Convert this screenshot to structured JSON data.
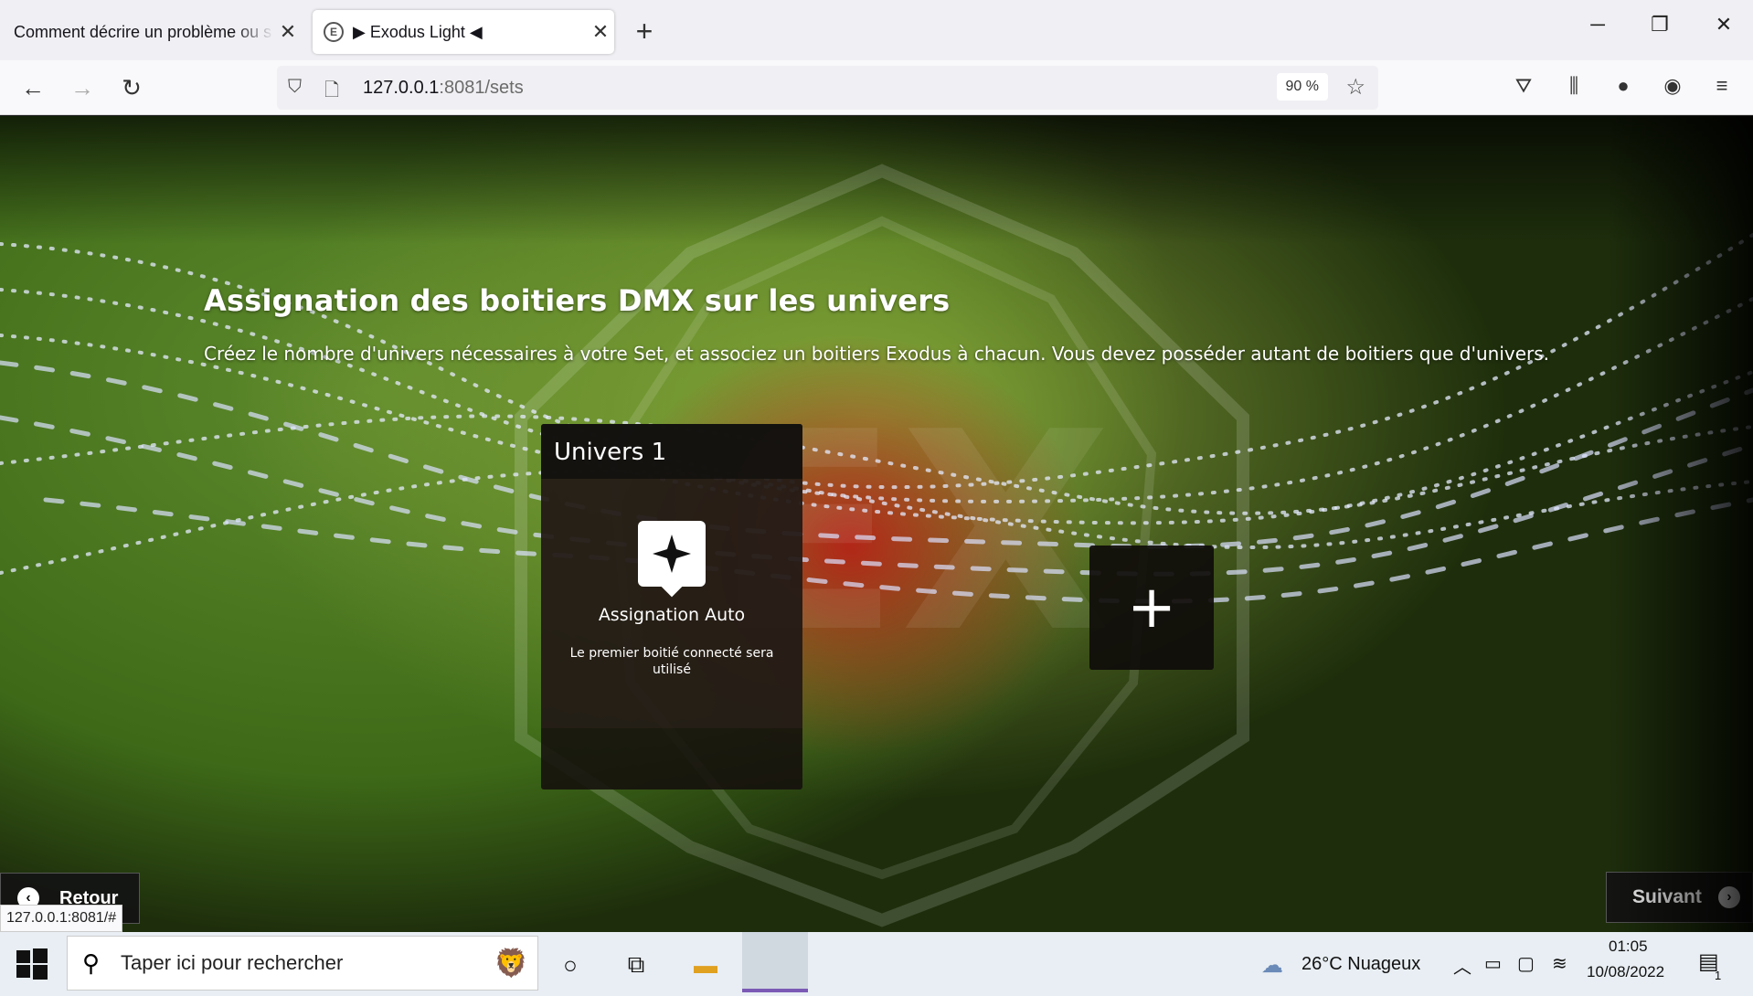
{
  "browser": {
    "tabs": [
      {
        "title": "Comment décrire un problème ou s",
        "active": false
      },
      {
        "title": "▶ Exodus Light ◀",
        "active": true
      }
    ],
    "url_host": "127.0.0.1",
    "url_path": ":8081/sets",
    "zoom": "90 %",
    "status_url": "127.0.0.1:8081/#"
  },
  "page": {
    "heading": "Assignation des boitiers DMX sur les univers",
    "subheading": "Créez le nombre d'univers nécessaires à votre Set, et associez un boitiers Exodus à chacun. Vous devez posséder autant de boitiers que d'univers.",
    "universe_card": {
      "title": "Univers 1",
      "option_title": "Assignation Auto",
      "option_desc": "Le premier boitié connecté sera utilisé"
    },
    "add_symbol": "+",
    "back_label": "Retour",
    "next_label": "Suivant"
  },
  "taskbar": {
    "search_placeholder": "Taper ici pour rechercher",
    "weather": "26°C  Nuageux",
    "time": "01:05",
    "date": "10/08/2022",
    "notifications": "1"
  },
  "colors": {
    "accent_active_task": "#7a5ab5",
    "dmx_red": "#be1414",
    "bg_green": "#5e8a2c"
  }
}
